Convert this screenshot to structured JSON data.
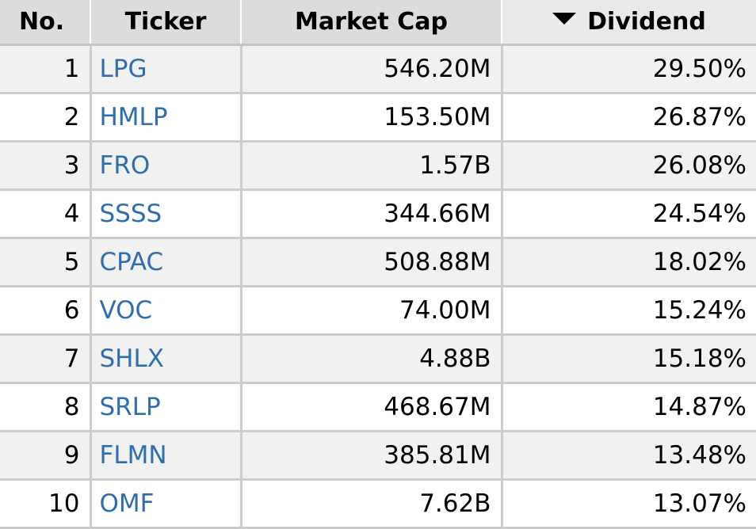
{
  "table": {
    "columns": {
      "no": "No.",
      "ticker": "Ticker",
      "market_cap": "Market Cap",
      "dividend": "Dividend"
    },
    "sort": {
      "column": "dividend",
      "direction": "descending"
    },
    "rows": [
      {
        "no": "1",
        "ticker": "LPG",
        "market_cap": "546.20M",
        "dividend": "29.50%"
      },
      {
        "no": "2",
        "ticker": "HMLP",
        "market_cap": "153.50M",
        "dividend": "26.87%"
      },
      {
        "no": "3",
        "ticker": "FRO",
        "market_cap": "1.57B",
        "dividend": "26.08%"
      },
      {
        "no": "4",
        "ticker": "SSSS",
        "market_cap": "344.66M",
        "dividend": "24.54%"
      },
      {
        "no": "5",
        "ticker": "CPAC",
        "market_cap": "508.88M",
        "dividend": "18.02%"
      },
      {
        "no": "6",
        "ticker": "VOC",
        "market_cap": "74.00M",
        "dividend": "15.24%"
      },
      {
        "no": "7",
        "ticker": "SHLX",
        "market_cap": "4.88B",
        "dividend": "15.18%"
      },
      {
        "no": "8",
        "ticker": "SRLP",
        "market_cap": "468.67M",
        "dividend": "14.87%"
      },
      {
        "no": "9",
        "ticker": "FLMN",
        "market_cap": "385.81M",
        "dividend": "13.48%"
      },
      {
        "no": "10",
        "ticker": "OMF",
        "market_cap": "7.62B",
        "dividend": "13.07%"
      }
    ]
  },
  "colors": {
    "header_bg": "#dcdcdc",
    "sorted_header_bg": "#e9e9e9",
    "row_alt_bg": "#f1f1f1",
    "ticker_link": "#2f6eae",
    "grid": "#cccccc"
  },
  "icons": {
    "sort": "sort-descending-arrow-icon"
  }
}
